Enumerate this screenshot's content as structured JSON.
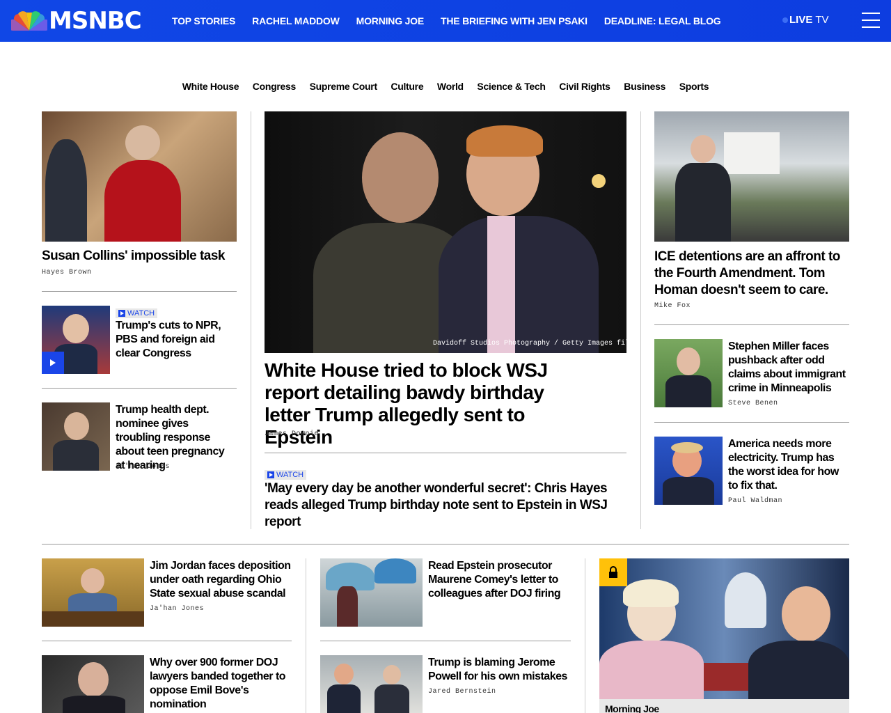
{
  "header": {
    "logo_text": "MSNBC",
    "nav": [
      "TOP STORIES",
      "RACHEL MADDOW",
      "MORNING JOE",
      "THE BRIEFING WITH JEN PSAKI",
      "DEADLINE: LEGAL BLOG"
    ],
    "live_bold": "LIVE",
    "live_rest": "TV"
  },
  "sections": [
    "White House",
    "Congress",
    "Supreme Court",
    "Culture",
    "World",
    "Science & Tech",
    "Civil Rights",
    "Business",
    "Sports"
  ],
  "left": {
    "story1": {
      "title": "Susan Collins' impossible task",
      "byline": "Hayes Brown"
    },
    "story2": {
      "badge": "WATCH",
      "title": "Trump's cuts to NPR, PBS and foreign aid clear Congress"
    },
    "story3": {
      "title": "Trump health dept. nominee gives troubling response about teen pregnancy at hearing",
      "byline": "Ja'han Jones"
    }
  },
  "center": {
    "caption": "Davidoff Studios Photography / Getty Images file",
    "title": "White House tried to block WSJ report detailing bawdy birthday letter Trump allegedly sent to Epstein",
    "byline": "James Downie",
    "watch": {
      "badge": "WATCH",
      "title": "'May every day be another wonderful secret': Chris Hayes reads alleged Trump birthday note sent to Epstein in WSJ report"
    }
  },
  "right": {
    "story1": {
      "title": "ICE detentions are an affront to the Fourth Amendment. Tom Homan doesn't seem to care.",
      "byline": "Mike Fox"
    },
    "story2": {
      "title": "Stephen Miller faces pushback after odd claims about immigrant crime in Minneapolis",
      "byline": "Steve Benen"
    },
    "story3": {
      "title": "America needs more electricity. Trump has the worst idea for how to fix that.",
      "byline": "Paul Waldman"
    }
  },
  "bottom": {
    "a1": {
      "title": "Jim Jordan faces deposition under oath regarding Ohio State sexual abuse scandal",
      "byline": "Ja'han Jones"
    },
    "a2": {
      "title": "Why over 900 former DOJ lawyers banded together to oppose Emil Bove's nomination"
    },
    "b1": {
      "title": "Read Epstein prosecutor Maurene Comey's letter to colleagues after DOJ firing"
    },
    "b2": {
      "title": "Trump is blaming Jerome Powell for his own mistakes",
      "byline": "Jared Bernstein"
    },
    "video": {
      "label": "Morning Joe"
    }
  }
}
